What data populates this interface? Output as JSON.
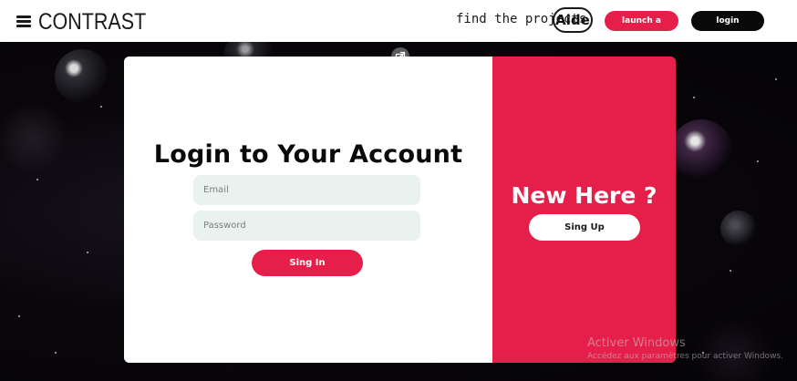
{
  "header": {
    "logo": "CONTRAST",
    "find_text": "find the projects",
    "aide_label": "Aide",
    "launch_label": "launch a project",
    "login_label": "login"
  },
  "login": {
    "title": "Login to Your Account",
    "email_placeholder": "Email",
    "password_placeholder": "Password",
    "signin_label": "Sing In"
  },
  "signup": {
    "heading": "New Here ?",
    "signup_label": "Sing Up"
  },
  "watermark": {
    "title": "Activer Windows",
    "subtitle": "Accédez aux paramètres pour activer Windows."
  },
  "colors": {
    "accent": "#e51f4a",
    "input_bg": "#eaf2ef",
    "dark": "#0a0a0a"
  },
  "icons": [
    "menu-icon",
    "expand-icon"
  ]
}
